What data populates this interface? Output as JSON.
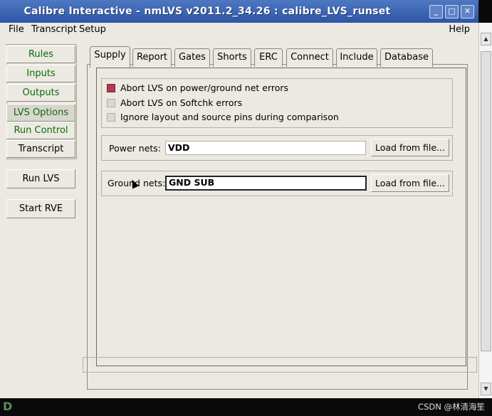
{
  "window": {
    "title": "Calibre Interactive - nmLVS v2011.2_34.26 : calibre_LVS_runset"
  },
  "window_buttons": {
    "minimize": "_",
    "maximize": "□",
    "close": "✕"
  },
  "menu": {
    "file": "File",
    "transcript": "Transcript",
    "setup": "Setup",
    "help": "Help"
  },
  "sidebar": {
    "items": [
      {
        "label": "Rules"
      },
      {
        "label": "Inputs"
      },
      {
        "label": "Outputs"
      },
      {
        "label": "LVS Options"
      },
      {
        "label": "Run Control"
      },
      {
        "label": "Transcript"
      }
    ],
    "run_lvs": "Run LVS",
    "start_rve": "Start RVE"
  },
  "tabs": [
    "Supply",
    "Report",
    "Gates",
    "Shorts",
    "ERC",
    "Connect",
    "Include",
    "Database"
  ],
  "supply": {
    "options": [
      {
        "label": "Abort LVS on power/ground net errors",
        "checked": true
      },
      {
        "label": "Abort LVS on Softchk errors",
        "checked": false
      },
      {
        "label": "Ignore layout and source pins during comparison",
        "checked": false
      }
    ],
    "power_label": "Power nets:",
    "power_value": "VDD",
    "ground_label": "Ground nets:",
    "ground_value": "GND SUB",
    "load_button": "Load from file..."
  },
  "taskbar": {
    "watermark": "CSDN @林清海笙"
  }
}
